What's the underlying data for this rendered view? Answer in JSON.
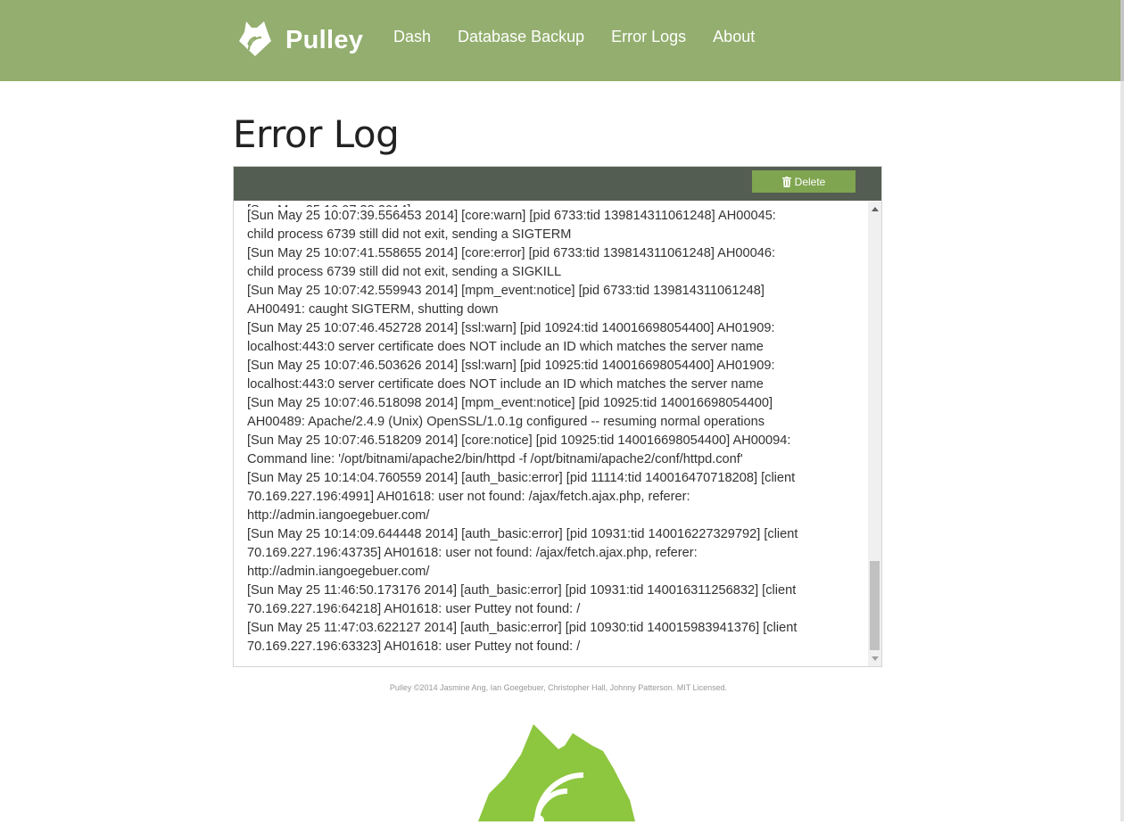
{
  "brand": {
    "name": "Pulley",
    "logo_icon": "pulley-logo-icon"
  },
  "nav": {
    "items": [
      {
        "label": "Dash"
      },
      {
        "label": "Database Backup"
      },
      {
        "label": "Error Logs"
      },
      {
        "label": "About"
      }
    ]
  },
  "page": {
    "title": "Error Log"
  },
  "toolbar": {
    "delete_label": "Delete",
    "delete_icon": "trash-icon"
  },
  "log": {
    "lines": [
      "[Sun May 25 10:07:39.556453 2014] [core:warn] [pid 6733:tid 139814311061248] AH00045:",
      "child process 6739 still did not exit, sending a SIGTERM",
      "[Sun May 25 10:07:41.558655 2014] [core:error] [pid 6733:tid 139814311061248] AH00046:",
      "child process 6739 still did not exit, sending a SIGKILL",
      "[Sun May 25 10:07:42.559943 2014] [mpm_event:notice] [pid 6733:tid 139814311061248]",
      "AH00491: caught SIGTERM, shutting down",
      "[Sun May 25 10:07:46.452728 2014] [ssl:warn] [pid 10924:tid 140016698054400] AH01909:",
      "localhost:443:0 server certificate does NOT include an ID which matches the server name",
      "[Sun May 25 10:07:46.503626 2014] [ssl:warn] [pid 10925:tid 140016698054400] AH01909:",
      "localhost:443:0 server certificate does NOT include an ID which matches the server name",
      "[Sun May 25 10:07:46.518098 2014] [mpm_event:notice] [pid 10925:tid 140016698054400]",
      "AH00489: Apache/2.4.9 (Unix) OpenSSL/1.0.1g configured -- resuming normal operations",
      "[Sun May 25 10:07:46.518209 2014] [core:notice] [pid 10925:tid 140016698054400] AH00094:",
      "Command line: '/opt/bitnami/apache2/bin/httpd -f /opt/bitnami/apache2/conf/httpd.conf'",
      "[Sun May 25 10:14:04.760559 2014] [auth_basic:error] [pid 11114:tid 140016470718208] [client",
      "70.169.227.196:4991] AH01618: user not found: /ajax/fetch.ajax.php, referer:",
      "http://admin.iangoegebuer.com/",
      "[Sun May 25 10:14:09.644448 2014] [auth_basic:error] [pid 10931:tid 140016227329792] [client",
      "70.169.227.196:43735] AH01618: user not found: /ajax/fetch.ajax.php, referer:",
      "http://admin.iangoegebuer.com/",
      "[Sun May 25 11:46:50.173176 2014] [auth_basic:error] [pid 10931:tid 140016311256832] [client",
      "70.169.227.196:64218] AH01618: user Puttey not found: /",
      "[Sun May 25 11:47:03.622127 2014] [auth_basic:error] [pid 10930:tid 140015983941376] [client",
      "70.169.227.196:63323] AH01618: user Puttey not found: /"
    ],
    "scroll_position": 1.0
  },
  "footer": {
    "text": "Pulley ©2014 Jasmine Ang, Ian Goegebuer, Christopher Hall, Johnny Patterson. MIT Licensed.",
    "logo_icon": "pulley-logo-large-icon"
  },
  "colors": {
    "navbar": "#93ae6e",
    "panel_header": "#545d51",
    "delete_button": "#7fa550",
    "logo_green": "#8dc63f"
  }
}
